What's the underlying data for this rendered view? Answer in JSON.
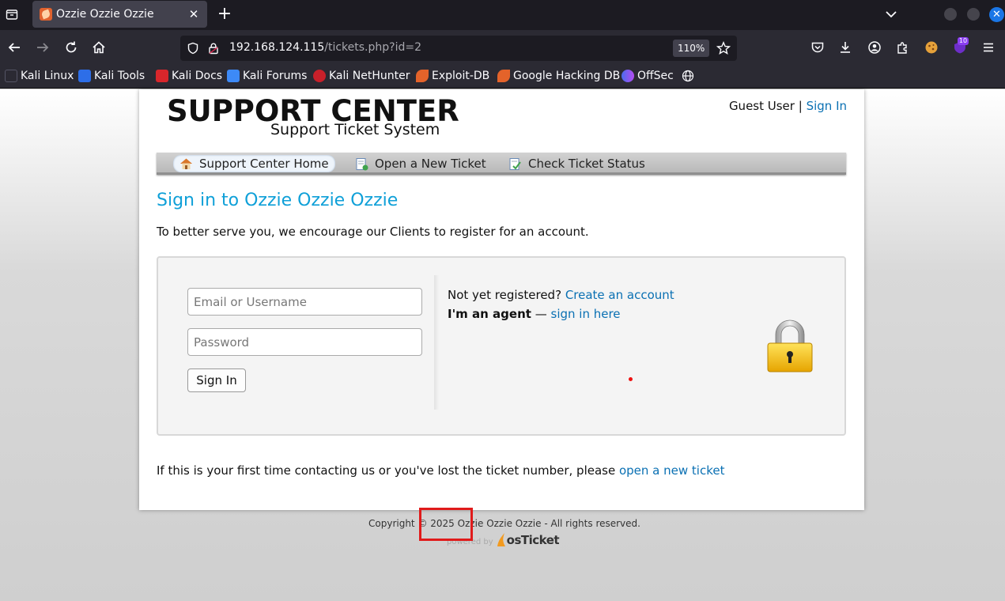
{
  "browser": {
    "tab_title": "Ozzie Ozzie Ozzie",
    "url_host": "192.168.124.115",
    "url_path": "/tickets.php?id=2",
    "zoom": "110%",
    "extension_badge": "10",
    "bookmarks": [
      "Kali Linux",
      "Kali Tools",
      "Kali Docs",
      "Kali Forums",
      "Kali NetHunter",
      "Exploit-DB",
      "Google Hacking DB",
      "OffSec"
    ]
  },
  "header": {
    "logo_title": "SUPPORT CENTER",
    "logo_subtitle": "Support Ticket System",
    "guest_label": "Guest User",
    "separator": "|",
    "sign_in_link": "Sign In"
  },
  "nav": {
    "items": [
      "Support Center Home",
      "Open a New Ticket",
      "Check Ticket Status"
    ]
  },
  "main": {
    "title": "Sign in to Ozzie Ozzie Ozzie",
    "intro": "To better serve you, we encourage our Clients to register for an account.",
    "username_placeholder": "Email or Username",
    "password_placeholder": "Password",
    "sign_in_button": "Sign In",
    "not_registered": "Not yet registered?",
    "create_account": "Create an account",
    "agent_label": "I'm an agent",
    "agent_dash": "—",
    "agent_link": "sign in here",
    "first_time_text": "If this is your first time contacting us or you've lost the ticket number, please",
    "open_ticket_link": "open a new ticket"
  },
  "footer": {
    "copyright": "Copyright © 2025 Ozzie Ozzie Ozzie - All rights reserved.",
    "powered_by": "powered by",
    "brand": "osTicket"
  }
}
